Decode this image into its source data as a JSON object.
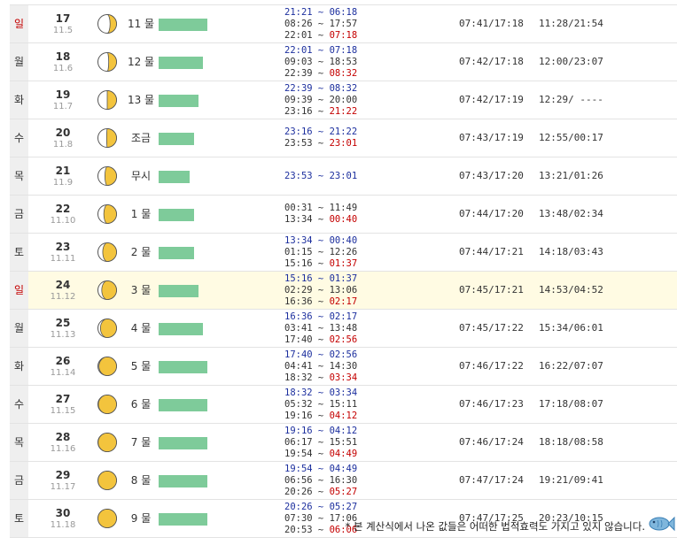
{
  "rows": [
    {
      "wd": "일",
      "sun": true,
      "d": "17",
      "l": "11.5",
      "phase": 0.4,
      "tide": "11 물",
      "bar": 55,
      "times": [
        {
          "a": "21:21 ~ ",
          "b": "06:18",
          "hi": true
        },
        {
          "a": "08:26 ~ ",
          "b": "17:57",
          "hi": false
        },
        {
          "a": "22:01 ~ ",
          "b": "07:18",
          "hi": false,
          "red": true
        }
      ],
      "sunrise": "07:41/17:18",
      "moon": "11:28/21:54"
    },
    {
      "wd": "월",
      "sun": false,
      "d": "18",
      "l": "11.6",
      "phase": 0.45,
      "tide": "12 물",
      "bar": 50,
      "times": [
        {
          "a": "22:01 ~ ",
          "b": "07:18",
          "hi": true
        },
        {
          "a": "09:03 ~ ",
          "b": "18:53",
          "hi": false
        },
        {
          "a": "22:39 ~ ",
          "b": "08:32",
          "hi": false,
          "red": true
        }
      ],
      "sunrise": "07:42/17:18",
      "moon": "12:00/23:07"
    },
    {
      "wd": "화",
      "sun": false,
      "d": "19",
      "l": "11.7",
      "phase": 0.5,
      "tide": "13 물",
      "bar": 45,
      "times": [
        {
          "a": "22:39 ~ ",
          "b": "08:32",
          "hi": true
        },
        {
          "a": "09:39 ~ ",
          "b": "20:00",
          "hi": false
        },
        {
          "a": "23:16 ~ ",
          "b": "21:22",
          "hi": false,
          "red": true
        }
      ],
      "sunrise": "07:42/17:19",
      "moon": "12:29/ ----"
    },
    {
      "wd": "수",
      "sun": false,
      "d": "20",
      "l": "11.8",
      "phase": 0.52,
      "tide": "조금",
      "bar": 40,
      "times": [
        {
          "a": "23:16 ~ ",
          "b": "21:22",
          "hi": true
        },
        {
          "a": "23:53 ~ ",
          "b": "23:01",
          "hi": false,
          "red": true
        }
      ],
      "sunrise": "07:43/17:19",
      "moon": "12:55/00:17"
    },
    {
      "wd": "목",
      "sun": false,
      "d": "21",
      "l": "11.9",
      "phase": 0.58,
      "tide": "무시",
      "bar": 35,
      "times": [
        {
          "a": "23:53 ~ ",
          "b": "23:01",
          "hi": true,
          "plain": true
        }
      ],
      "sunrise": "07:43/17:20",
      "moon": "13:21/01:26"
    },
    {
      "wd": "금",
      "sun": false,
      "d": "22",
      "l": "11.10",
      "phase": 0.62,
      "tide": "1 물",
      "bar": 40,
      "times": [
        {
          "a": "00:31 ~ ",
          "b": "11:49",
          "hi": false
        },
        {
          "a": "13:34 ~ ",
          "b": "00:40",
          "hi": false,
          "red": true
        }
      ],
      "sunrise": "07:44/17:20",
      "moon": "13:48/02:34"
    },
    {
      "wd": "토",
      "sun": false,
      "d": "23",
      "l": "11.11",
      "phase": 0.66,
      "tide": "2 물",
      "bar": 40,
      "times": [
        {
          "a": "13:34 ~ ",
          "b": "00:40",
          "hi": true
        },
        {
          "a": "01:15 ~ ",
          "b": "12:26",
          "hi": false
        },
        {
          "a": "15:16 ~ ",
          "b": "01:37",
          "hi": false,
          "red": true
        }
      ],
      "sunrise": "07:44/17:21",
      "moon": "14:18/03:43"
    },
    {
      "wd": "일",
      "sun": true,
      "d": "24",
      "l": "11.12",
      "phase": 0.7,
      "tide": "3 물",
      "bar": 45,
      "hl": true,
      "times": [
        {
          "a": "15:16 ~ ",
          "b": "01:37",
          "hi": true
        },
        {
          "a": "02:29 ~ ",
          "b": "13:06",
          "hi": false
        },
        {
          "a": "16:36 ~ ",
          "b": "02:17",
          "hi": false,
          "red": true
        }
      ],
      "sunrise": "07:45/17:21",
      "moon": "14:53/04:52"
    },
    {
      "wd": "월",
      "sun": false,
      "d": "25",
      "l": "11.13",
      "phase": 0.76,
      "tide": "4 물",
      "bar": 50,
      "times": [
        {
          "a": "16:36 ~ ",
          "b": "02:17",
          "hi": true
        },
        {
          "a": "03:41 ~ ",
          "b": "13:48",
          "hi": false
        },
        {
          "a": "17:40 ~ ",
          "b": "02:56",
          "hi": false,
          "red": true
        }
      ],
      "sunrise": "07:45/17:22",
      "moon": "15:34/06:01"
    },
    {
      "wd": "화",
      "sun": false,
      "d": "26",
      "l": "11.14",
      "phase": 0.85,
      "tide": "5 물",
      "bar": 55,
      "times": [
        {
          "a": "17:40 ~ ",
          "b": "02:56",
          "hi": true
        },
        {
          "a": "04:41 ~ ",
          "b": "14:30",
          "hi": false
        },
        {
          "a": "18:32 ~ ",
          "b": "03:34",
          "hi": false,
          "red": true
        }
      ],
      "sunrise": "07:46/17:22",
      "moon": "16:22/07:07"
    },
    {
      "wd": "수",
      "sun": false,
      "d": "27",
      "l": "11.15",
      "phase": 0.9,
      "tide": "6 물",
      "bar": 55,
      "times": [
        {
          "a": "18:32 ~ ",
          "b": "03:34",
          "hi": true
        },
        {
          "a": "05:32 ~ ",
          "b": "15:11",
          "hi": false
        },
        {
          "a": "19:16 ~ ",
          "b": "04:12",
          "hi": false,
          "red": true
        }
      ],
      "sunrise": "07:46/17:23",
      "moon": "17:18/08:07"
    },
    {
      "wd": "목",
      "sun": false,
      "d": "28",
      "l": "11.16",
      "phase": 0.93,
      "tide": "7 물",
      "bar": 55,
      "times": [
        {
          "a": "19:16 ~ ",
          "b": "04:12",
          "hi": true
        },
        {
          "a": "06:17 ~ ",
          "b": "15:51",
          "hi": false
        },
        {
          "a": "19:54 ~ ",
          "b": "04:49",
          "hi": false,
          "red": true
        }
      ],
      "sunrise": "07:46/17:24",
      "moon": "18:18/08:58"
    },
    {
      "wd": "금",
      "sun": false,
      "d": "29",
      "l": "11.17",
      "phase": 0.95,
      "tide": "8 물",
      "bar": 55,
      "times": [
        {
          "a": "19:54 ~ ",
          "b": "04:49",
          "hi": true
        },
        {
          "a": "06:56 ~ ",
          "b": "16:30",
          "hi": false
        },
        {
          "a": "20:26 ~ ",
          "b": "05:27",
          "hi": false,
          "red": true
        }
      ],
      "sunrise": "07:47/17:24",
      "moon": "19:21/09:41"
    },
    {
      "wd": "토",
      "sun": false,
      "d": "30",
      "l": "11.18",
      "phase": 0.97,
      "tide": "9 물",
      "bar": 55,
      "times": [
        {
          "a": "20:26 ~ ",
          "b": "05:27",
          "hi": true
        },
        {
          "a": "07:30 ~ ",
          "b": "17:06",
          "hi": false
        },
        {
          "a": "20:53 ~ ",
          "b": "06:06",
          "hi": false,
          "red": true
        }
      ],
      "sunrise": "07:47/17:25",
      "moon": "20:23/10:15"
    }
  ],
  "footer": {
    "note": "* 본 계산식에서 나온 값들은 어떠한 법적효력도 가지고 있지 않습니다."
  },
  "icons": {
    "moon": "moon-phase-icon",
    "fish": "fish-logo-icon"
  },
  "colors": {
    "bar": "#7ecb9a",
    "high": "#1c2f9e",
    "low_red": "#c40000",
    "moon_fill": "#f3c43d"
  }
}
